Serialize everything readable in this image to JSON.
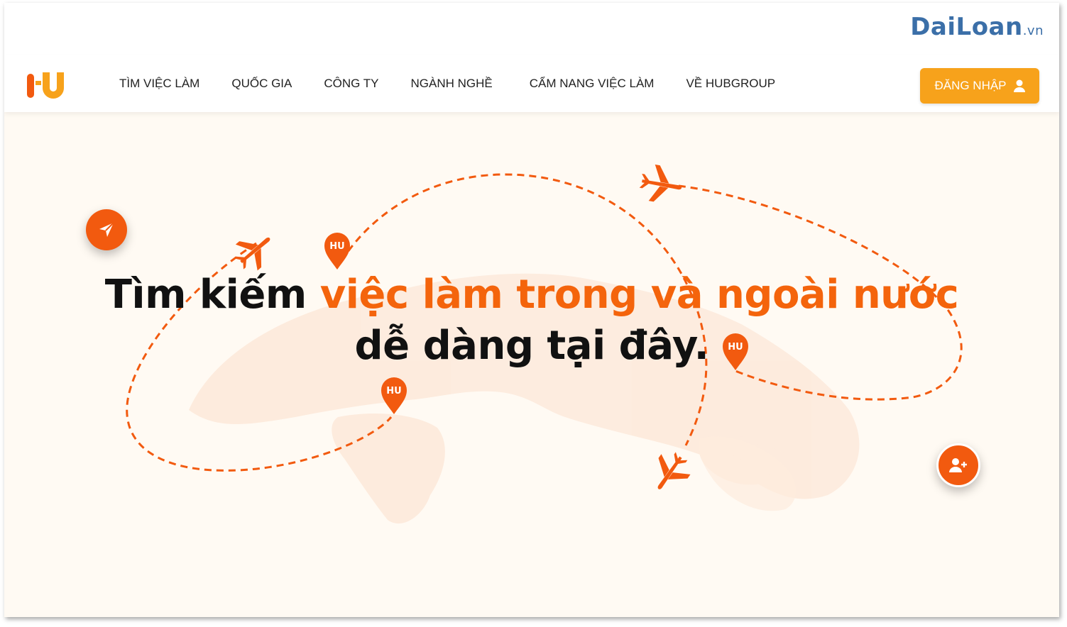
{
  "watermark": {
    "brand": "DaiLoan",
    "suffix": ".vn"
  },
  "header": {
    "logo_alt": "HU",
    "nav": [
      {
        "label": "TÌM VIỆC LÀM"
      },
      {
        "label": "QUỐC GIA"
      },
      {
        "label": "CÔNG TY"
      },
      {
        "label": "NGÀNH NGHỀ"
      },
      {
        "label": "CẨM NANG VIỆC LÀM"
      },
      {
        "label": "VỀ HUBGROUP"
      }
    ],
    "login_label": "ĐĂNG NHẬP"
  },
  "hero": {
    "headline_lead": "Tìm kiếm ",
    "headline_accent": "việc làm trong và ngoài nước",
    "headline_tail": "dễ dàng tại đây.",
    "pin_label": "HU"
  },
  "icons": {
    "send": "paper-plane-icon",
    "user_add": "user-plus-icon",
    "user": "user-icon",
    "airplane": "airplane-icon",
    "pin": "map-pin-icon"
  },
  "colors": {
    "accent": "#f4640c",
    "login": "#f7a21b",
    "hero_bg": "#fffaf3",
    "watermark": "#3b6fa8"
  }
}
